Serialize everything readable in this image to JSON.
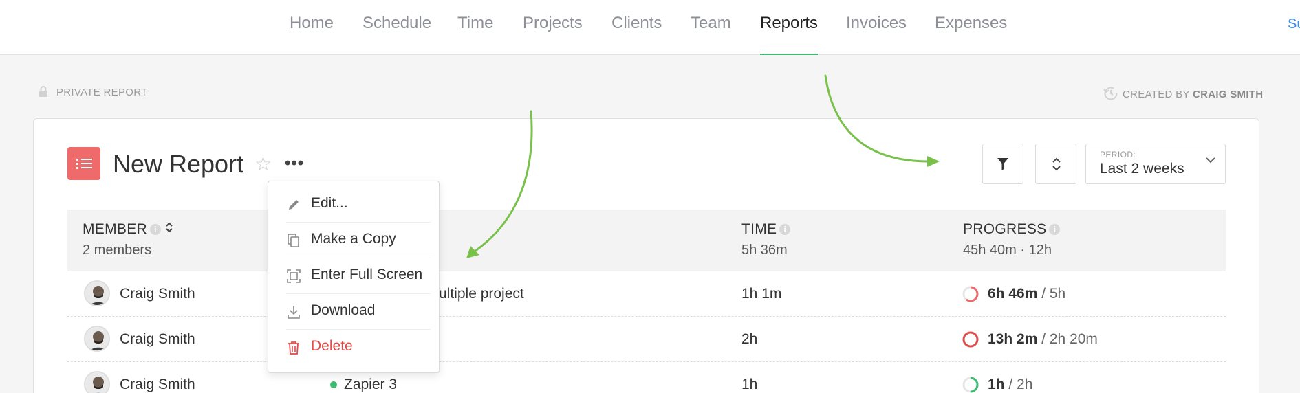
{
  "nav": {
    "items": [
      "Home",
      "Schedule",
      "Time",
      "Projects",
      "Clients",
      "Team",
      "Reports",
      "Invoices",
      "Expenses"
    ],
    "active": "Reports",
    "support_label": "Su"
  },
  "meta": {
    "private_label": "PRIVATE REPORT",
    "created_prefix": "CREATED BY",
    "created_by": "CRAIG SMITH"
  },
  "report": {
    "title": "New Report",
    "more_label": "•••",
    "period_label": "PERIOD:",
    "period_value": "Last 2 weeks"
  },
  "table": {
    "columns": [
      {
        "title": "MEMBER",
        "sub": "2 members"
      },
      {
        "title": "TIME",
        "sub": "5h 36m"
      },
      {
        "title": "PROGRESS",
        "sub": "45h 40m · 12h"
      }
    ],
    "rows": [
      {
        "member": "Craig Smith",
        "task": "ultiple project",
        "task_dot": false,
        "time": "1h 1m",
        "progress_main": "6h 46m",
        "progress_budget": " / 5h",
        "ring_color": "#ef6b6b",
        "ring_fill": 0.6
      },
      {
        "member": "Craig Smith",
        "task": "",
        "task_dot": false,
        "time": "2h",
        "progress_main": "13h 2m",
        "progress_budget": " / 2h 20m",
        "ring_color": "#e04b4b",
        "ring_fill": 1.0
      },
      {
        "member": "Craig Smith",
        "task": "Zapier 3",
        "task_dot": true,
        "time": "1h",
        "progress_main": "1h",
        "progress_budget": " / 2h",
        "ring_color": "#3dbb6e",
        "ring_fill": 0.5
      }
    ]
  },
  "menu": {
    "items": [
      {
        "label": "Edit...",
        "icon": "pencil-icon"
      },
      {
        "label": "Make a Copy",
        "icon": "copy-icon"
      },
      {
        "label": "Enter Full Screen",
        "icon": "fullscreen-icon"
      },
      {
        "label": "Download",
        "icon": "download-icon"
      },
      {
        "label": "Delete",
        "icon": "trash-icon"
      }
    ]
  },
  "colors": {
    "accent": "#43b870",
    "brand_red": "#ef6b6b",
    "danger": "#e04b4b",
    "arrow": "#7ac14b"
  }
}
